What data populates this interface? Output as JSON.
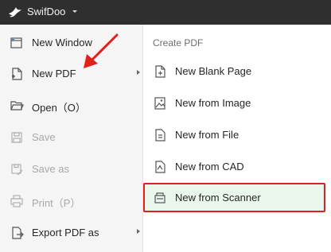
{
  "app": {
    "name": "SwifDoo"
  },
  "left_menu": [
    {
      "label": "New Window",
      "icon": "new-window-icon",
      "enabled": true,
      "has_submenu": false
    },
    {
      "label": "New PDF",
      "icon": "new-pdf-icon",
      "enabled": true,
      "has_submenu": true
    },
    {
      "label": "Open（O）",
      "icon": "folder-open-icon",
      "enabled": true,
      "has_submenu": false
    },
    {
      "label": "Save",
      "icon": "save-icon",
      "enabled": false,
      "has_submenu": false
    },
    {
      "label": "Save as",
      "icon": "save-as-icon",
      "enabled": false,
      "has_submenu": false
    },
    {
      "label": "Print（P）",
      "icon": "print-icon",
      "enabled": false,
      "has_submenu": false
    },
    {
      "label": "Export PDF as",
      "icon": "export-icon",
      "enabled": true,
      "has_submenu": true
    }
  ],
  "submenu": {
    "title": "Create PDF",
    "items": [
      {
        "label": "New Blank Page",
        "icon": "blank-page-icon"
      },
      {
        "label": "New from Image",
        "icon": "image-file-icon"
      },
      {
        "label": "New from File",
        "icon": "file-icon"
      },
      {
        "label": "New from CAD",
        "icon": "cad-file-icon"
      },
      {
        "label": "New from Scanner",
        "icon": "scanner-icon",
        "highlighted": true
      }
    ]
  },
  "colors": {
    "topbar": "#2f2f2f",
    "highlight_border": "#e0201b",
    "highlight_fill": "#eaf7ec",
    "annotation_arrow": "#e0201b"
  }
}
